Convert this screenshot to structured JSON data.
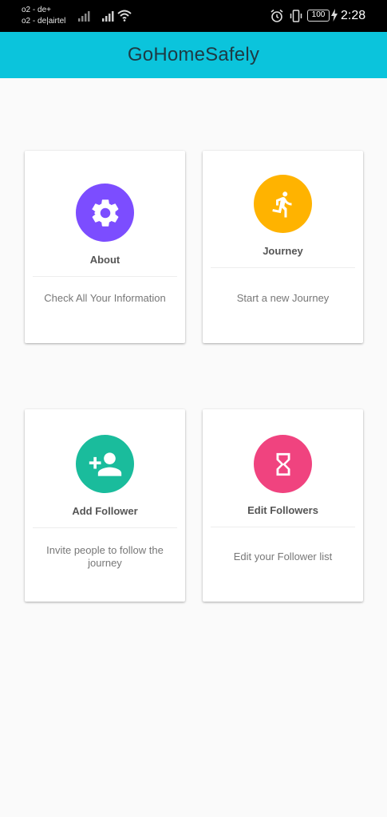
{
  "status_bar": {
    "carrier_1": "o2 - de+",
    "carrier_2": "o2 - de|airtel",
    "battery": "100",
    "time": "2:28",
    "icons": [
      "signal-icon",
      "signal-icon",
      "wifi-icon",
      "alarm-icon",
      "vibrate-icon",
      "battery-icon",
      "charging-icon"
    ]
  },
  "app_bar": {
    "title": "GoHomeSafely",
    "color": "#0bc4dc"
  },
  "cards": [
    {
      "title": "About",
      "description": "Check All Your Information",
      "icon": "gear-icon",
      "color": "#7c4dff"
    },
    {
      "title": "Journey",
      "description": "Start a new Journey",
      "icon": "running-person-icon",
      "color": "#ffb300"
    },
    {
      "title": "Add Follower",
      "description": "Invite people to follow the journey",
      "icon": "add-person-icon",
      "color": "#1abc9c"
    },
    {
      "title": "Edit Followers",
      "description": "Edit your Follower list",
      "icon": "hourglass-icon",
      "color": "#f0437f"
    }
  ]
}
